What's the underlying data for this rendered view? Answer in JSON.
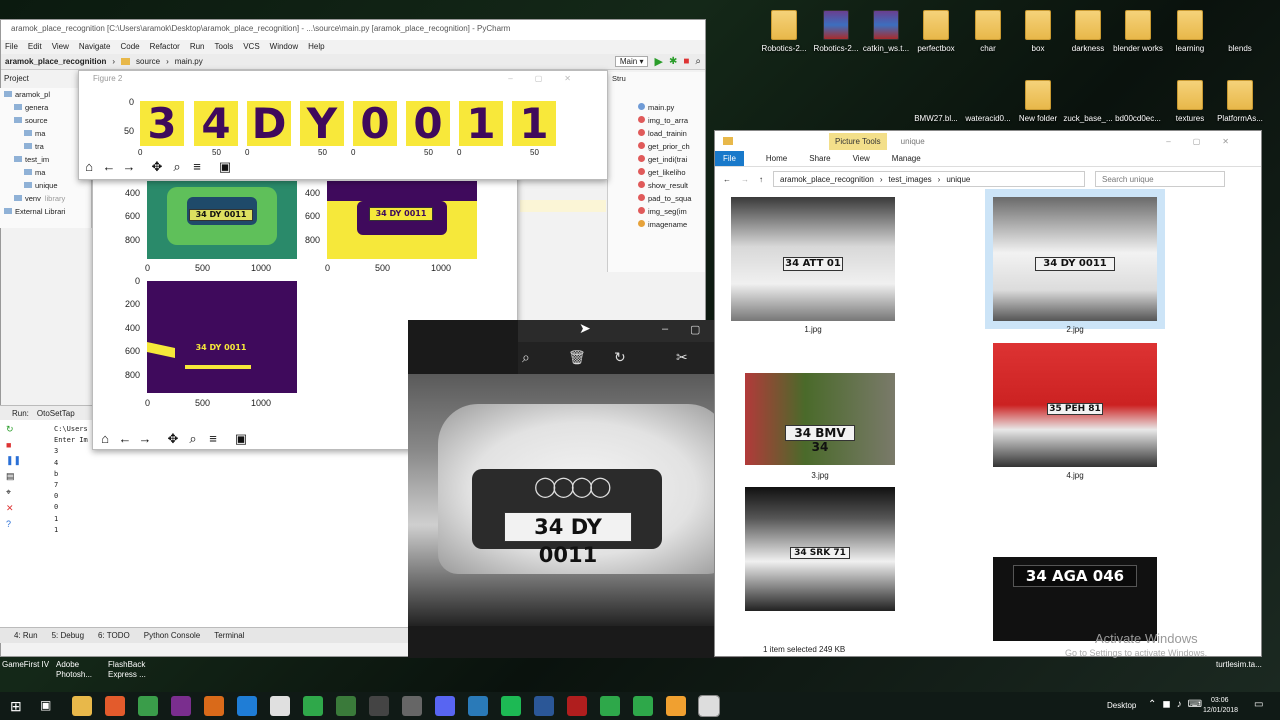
{
  "desktop_icons": [
    {
      "label": "Robotics-2...",
      "type": "folder"
    },
    {
      "label": "Robotics-2...",
      "type": "winrar"
    },
    {
      "label": "catkin_ws.t...",
      "type": "winrar"
    },
    {
      "label": "perfectbox",
      "type": "folder"
    },
    {
      "label": "char",
      "type": "folder"
    },
    {
      "label": "box",
      "type": "folder"
    },
    {
      "label": "darkness",
      "type": "folder"
    },
    {
      "label": "blender works",
      "type": "folder"
    },
    {
      "label": "learning",
      "type": "folder"
    },
    {
      "label": "blends",
      "type": "file"
    },
    {
      "label": "BMW27.bl...",
      "type": "file"
    },
    {
      "label": "wateracid0...",
      "type": "file"
    },
    {
      "label": "New folder",
      "type": "folder"
    },
    {
      "label": "zuck_base_...",
      "type": "file"
    },
    {
      "label": "bd00cd0ec...",
      "type": "file"
    },
    {
      "label": "textures",
      "type": "folder"
    },
    {
      "label": "PlatformAs...",
      "type": "folder"
    }
  ],
  "bottom_left_icons": [
    "GameFirst IV",
    "Adobe Photosh...",
    "FlashBack Express ..."
  ],
  "pycharm": {
    "title": "aramok_place_recognition [C:\\Users\\aramok\\Desktop\\aramok_place_recognition] - ...\\source\\main.py [aramok_place_recognition] - PyCharm",
    "menu": [
      "File",
      "Edit",
      "View",
      "Navigate",
      "Code",
      "Refactor",
      "Run",
      "Tools",
      "VCS",
      "Window",
      "Help"
    ],
    "breadcrumb": [
      "aramok_place_recognition",
      "source",
      "main.py"
    ],
    "run_config": "Main",
    "project_label": "Project",
    "tree": [
      "aramok_pl",
      "genera",
      "source",
      "ma",
      "tra",
      "test_im",
      "ma",
      "unique",
      "venv",
      "External Librari"
    ],
    "venv_note": "library",
    "structure_label": "Stru",
    "structure_items": [
      "main.py",
      "img_to_arra",
      "load_trainin",
      "get_prior_ch",
      "get_indi(trai",
      "get_likeliho",
      "show_result",
      "pad_to_squa",
      "img_seg(im",
      "imagename"
    ],
    "run_label": "Run:",
    "run_tab": "OtoSetTap",
    "console_lines": [
      "C:\\Users",
      "Enter Im",
      "3",
      "4",
      "b",
      "7",
      "0",
      "0",
      "1",
      "1"
    ],
    "bottom_tabs": [
      "4: Run",
      "5: Debug",
      "6: TODO",
      "Python Console",
      "Terminal"
    ]
  },
  "figure2": {
    "title": "Figure 2",
    "characters": [
      "3",
      "4",
      "D",
      "Y",
      "0",
      "0",
      "1",
      "1"
    ],
    "y_ticks": [
      "0",
      "50"
    ],
    "x_ticks_partial": [
      "0",
      "50",
      "0",
      "50",
      "0",
      "50",
      "0",
      "50"
    ]
  },
  "figure1": {
    "y_ticks_top": [
      "400",
      "600",
      "800"
    ],
    "x_ticks": [
      "0",
      "500",
      "1000"
    ],
    "y_ticks_bottom": [
      "0",
      "200",
      "400",
      "600",
      "800"
    ],
    "plates": [
      "34 DY 0011",
      "34 DY 0011",
      "34 DY 0011"
    ]
  },
  "photo_viewer": {
    "plate": "34 DY 0011"
  },
  "explorer": {
    "title": "unique",
    "picture_tools": "Picture Tools",
    "ribbon_tabs": [
      "File",
      "Home",
      "Share",
      "View",
      "Manage"
    ],
    "path": [
      "aramok_place_recognition",
      "test_images",
      "unique"
    ],
    "search_placeholder": "Search unique",
    "files": [
      {
        "name": "1.jpg",
        "plate": "34 ATT 01"
      },
      {
        "name": "2.jpg",
        "plate": "34 DY 0011"
      },
      {
        "name": "3.jpg",
        "plate": "34 BMV 34"
      },
      {
        "name": "4.jpg",
        "plate": "35 PEH 81"
      },
      {
        "name": "",
        "plate": "34 SRK 71"
      },
      {
        "name": "",
        "plate": "34 AGA 046"
      }
    ],
    "status": "1 item selected  249 KB",
    "watermark1": "Activate Windows",
    "watermark2": "Go to Settings to activate Windows."
  },
  "taskbar": {
    "desktop_label": "Desktop",
    "time": "03:06",
    "date": "12/01/2018",
    "tray_app": "turtlesim.ta..."
  }
}
